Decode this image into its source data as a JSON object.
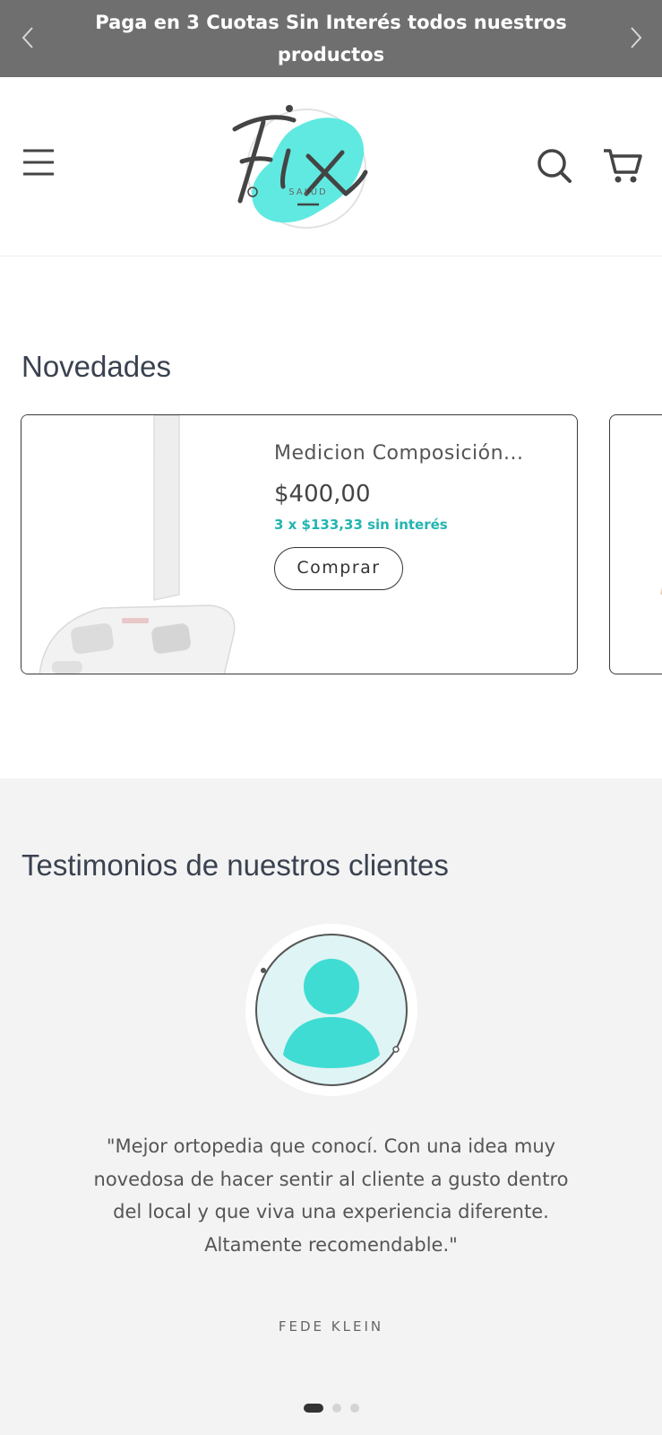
{
  "announcement": {
    "text": "Paga en 3 Cuotas Sin Interés todos nuestros productos"
  },
  "header": {
    "logo_alt": "Fix Salud",
    "logo_word": "Fix",
    "logo_sub": "SALUD",
    "icons": [
      "menu-icon",
      "search-icon",
      "cart-icon"
    ],
    "colors": {
      "logo_accent": "#5fe9e1"
    }
  },
  "novedades": {
    "title": "Novedades",
    "products": [
      {
        "name": "Medicion Composición...",
        "price": "$400,00",
        "installments": "3 x $133,33 sin interés",
        "buy_label": "Comprar"
      }
    ]
  },
  "testimonials": {
    "title": "Testimonios de nuestros clientes",
    "quote": "\"Mejor ortopedia que conocí. Con una idea muy novedosa de hacer sentir al cliente a gusto dentro del local y que viva una experiencia diferente. Altamente recomendable.\"",
    "author": "FEDE KLEIN",
    "slides": 3,
    "active_slide": 1
  },
  "colors": {
    "announcement_bg": "#6f6f6f",
    "accent": "#22b5b0",
    "testimonial_bg": "#f3f3f3"
  }
}
